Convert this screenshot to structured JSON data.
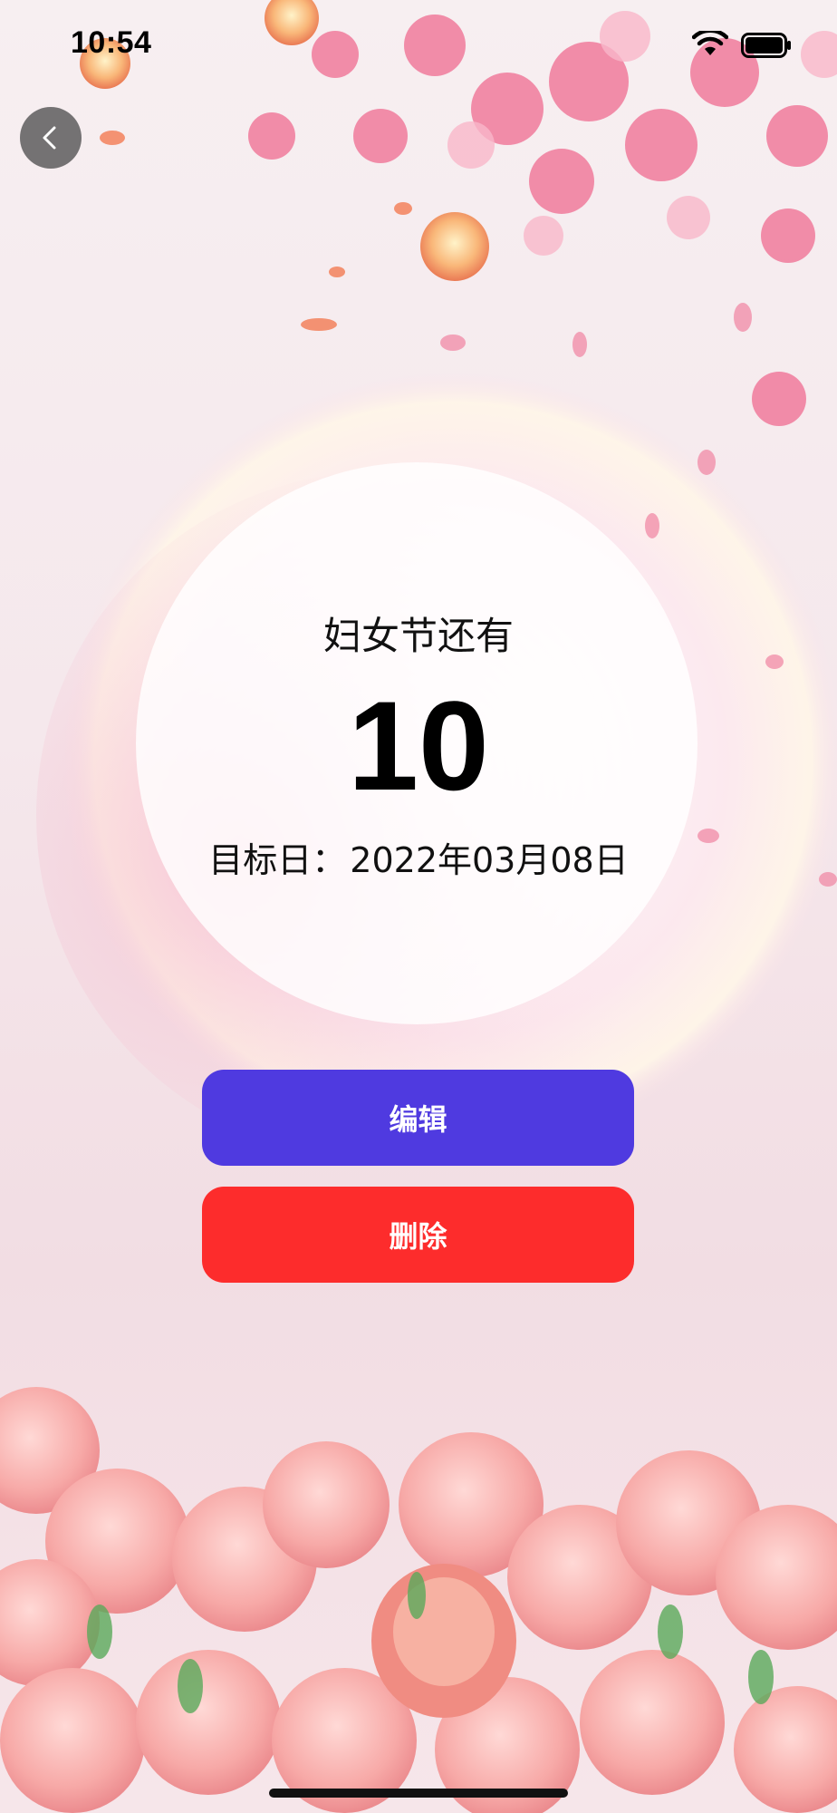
{
  "status_bar": {
    "time": "10:54"
  },
  "countdown": {
    "title": "妇女节还有",
    "days": "10",
    "target_label": "目标日：",
    "target_date": "2022年03月08日"
  },
  "actions": {
    "edit_label": "编辑",
    "delete_label": "删除"
  },
  "icons": {
    "back": "chevron-left-icon",
    "wifi": "wifi-icon",
    "battery": "battery-icon"
  },
  "colors": {
    "edit_button": "#4f3ae0",
    "delete_button": "#fd2c2c"
  }
}
